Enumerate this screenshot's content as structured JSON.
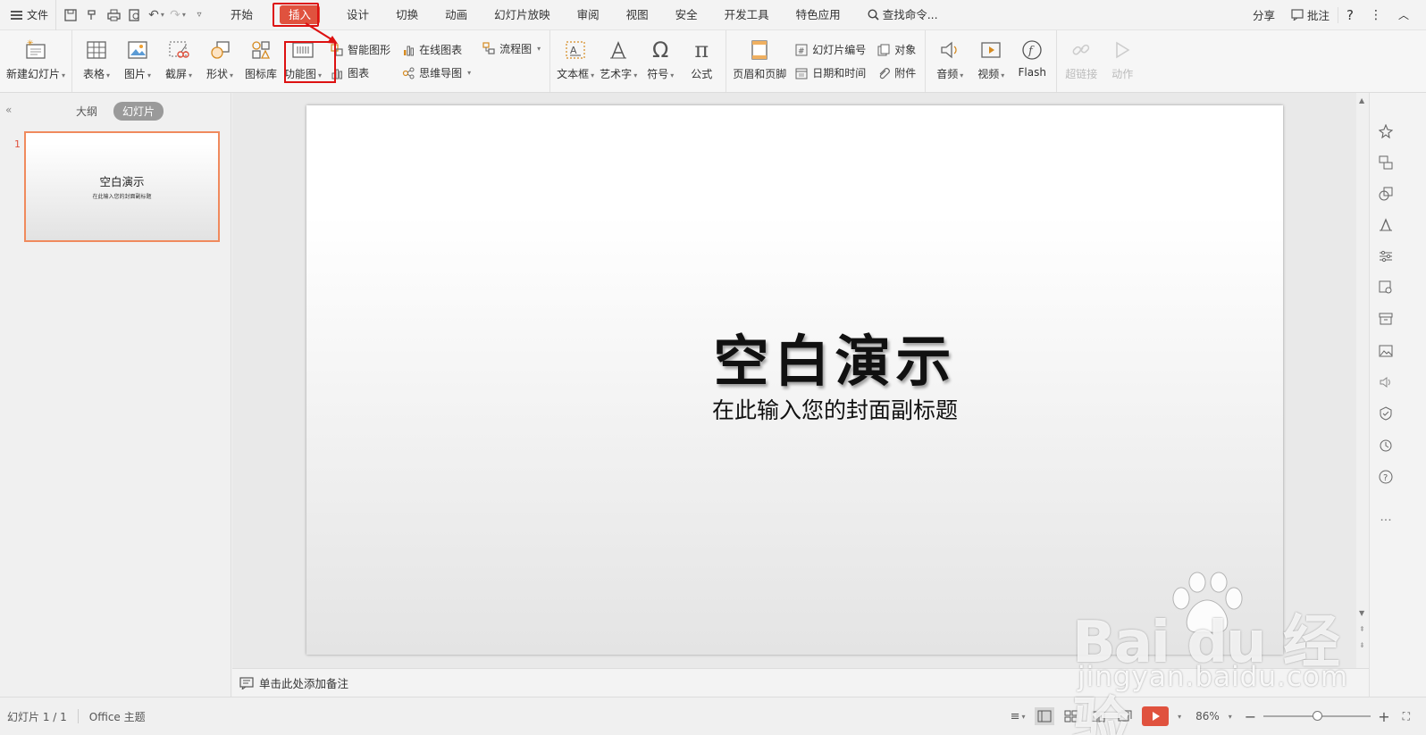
{
  "menubar": {
    "file_label": "文件",
    "tabs": [
      "开始",
      "插入",
      "设计",
      "切换",
      "动画",
      "幻灯片放映",
      "审阅",
      "视图",
      "安全",
      "开发工具",
      "特色应用"
    ],
    "search_label": "查找命令...",
    "share_label": "分享",
    "comment_label": "批注",
    "help_label": "?",
    "active_tab": "插入"
  },
  "ribbon": {
    "new_slide": "新建幻灯片",
    "table": "表格",
    "picture": "图片",
    "screenshot": "截屏",
    "shape": "形状",
    "icon_lib": "图标库",
    "function_chart": "功能图",
    "smart_art": "智能图形",
    "chart": "图表",
    "online_chart": "在线图表",
    "mind_map": "思维导图",
    "flowchart": "流程图",
    "textbox": "文本框",
    "wordart": "艺术字",
    "symbol": "符号",
    "formula": "公式",
    "header_footer": "页眉和页脚",
    "slide_number": "幻灯片编号",
    "date_time": "日期和时间",
    "object": "对象",
    "attachment": "附件",
    "audio": "音频",
    "video": "视频",
    "flash": "Flash",
    "hyperlink": "超链接",
    "action": "动作"
  },
  "leftpanel": {
    "tab_outline": "大纲",
    "tab_slides": "幻灯片",
    "slide_number": "1",
    "thumb_title": "空白演示",
    "thumb_subtitle": "在此输入您的封面副标题"
  },
  "slide": {
    "title": "空白演示",
    "subtitle": "在此输入您的封面副标题"
  },
  "notes": {
    "placeholder": "单击此处添加备注"
  },
  "statusbar": {
    "slide_counter": "幻灯片 1 / 1",
    "theme": "Office 主题",
    "zoom": "86%",
    "zoom_level": 0.86
  },
  "watermark": {
    "brand": "Bai du 经验",
    "url": "jingyan.baidu.com"
  },
  "colors": {
    "accent": "#e0523e",
    "highlight_box": "#dd1111",
    "thumb_border": "#f08a5d"
  }
}
